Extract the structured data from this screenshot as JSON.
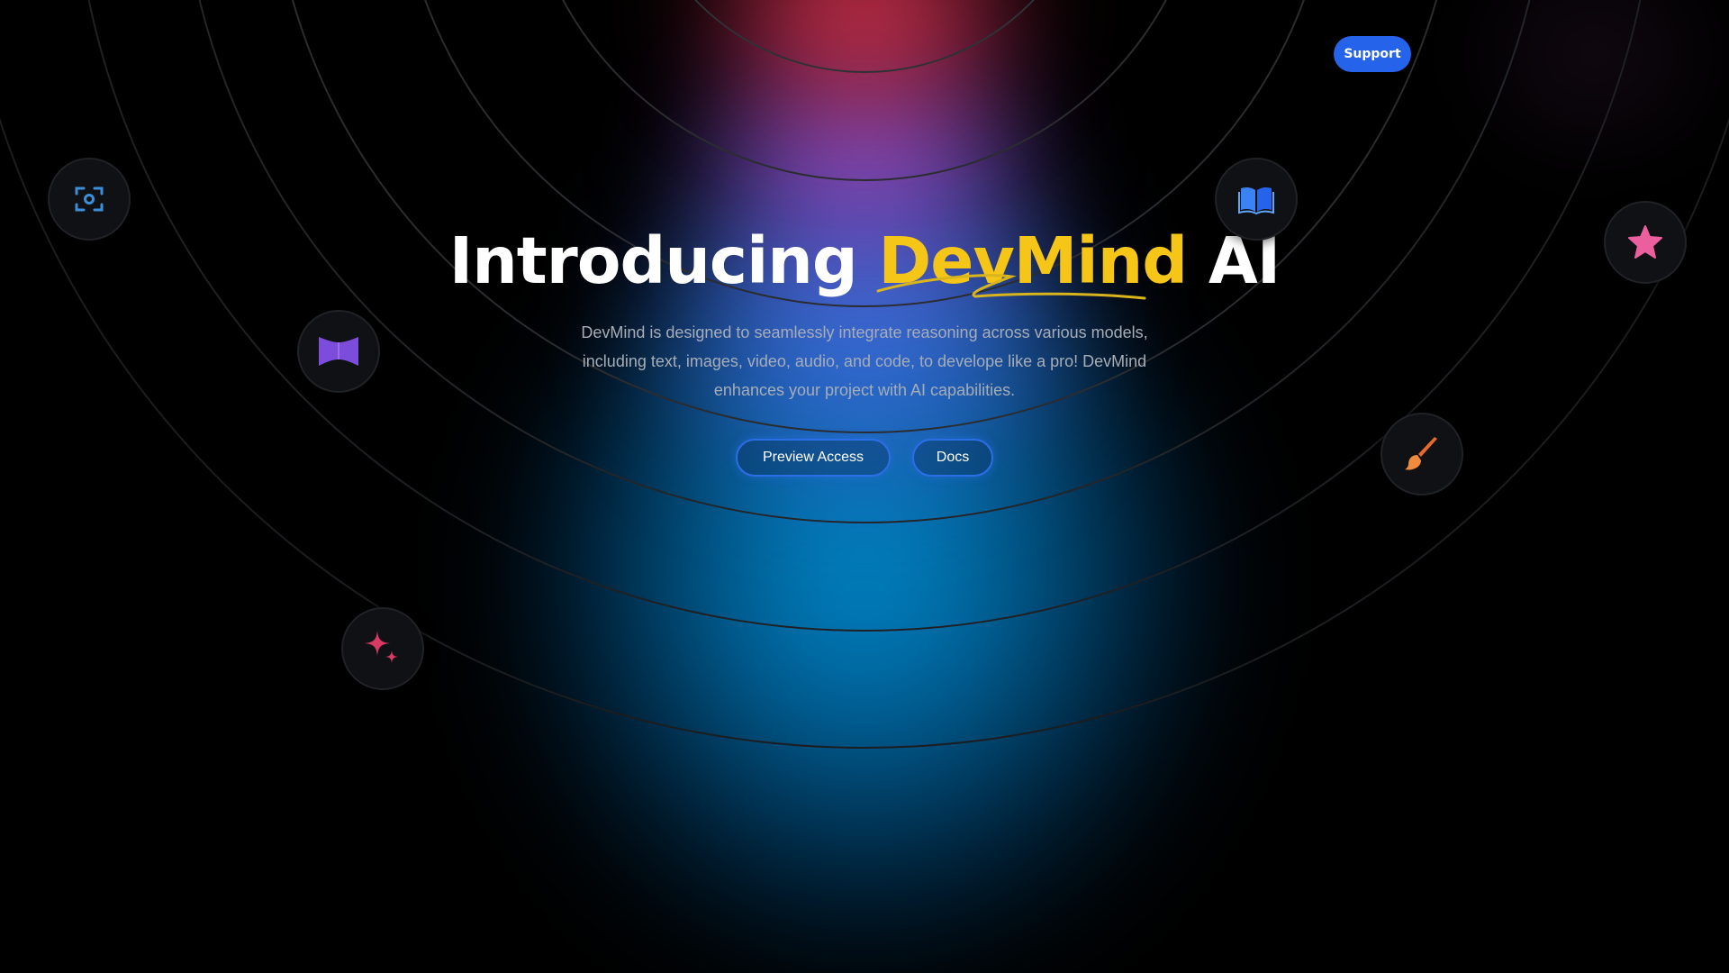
{
  "header": {
    "support_label": "Support"
  },
  "hero": {
    "title_prefix": "Introducing ",
    "title_brand": "DevMind",
    "title_suffix": " AI",
    "subtitle": "DevMind is designed to seamlessly integrate reasoning across various models, including text, images, video, audio, and code, to develope like a pro! DevMind enhances your project with AI capabilities."
  },
  "actions": {
    "preview_label": "Preview Access",
    "docs_label": "Docs"
  },
  "icons": [
    {
      "name": "camera-focus-icon",
      "color": "#3b8fd9"
    },
    {
      "name": "book-icon",
      "color": "#3b82f6"
    },
    {
      "name": "star-icon",
      "color": "#ec5f9e"
    },
    {
      "name": "ribbon-icon",
      "color": "#7c4ddb"
    },
    {
      "name": "paintbrush-icon",
      "color": "#e56a2c"
    },
    {
      "name": "sparkle-icon",
      "color": "#d83a63"
    }
  ],
  "colors": {
    "brand": "#f5c518",
    "accent": "#2563eb",
    "background": "#000000",
    "subtitle": "#a6adb7"
  }
}
